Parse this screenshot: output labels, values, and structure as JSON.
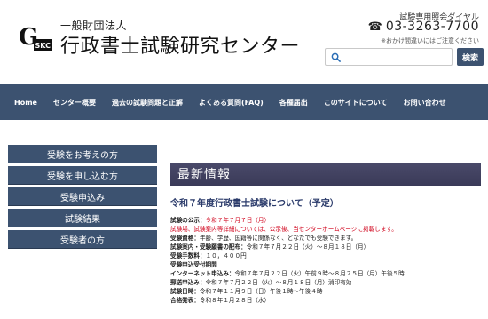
{
  "header": {
    "logo_sub": "一般財団法人",
    "logo_main": "行政書士試験研究センター",
    "tel_label": "試験専用照会ダイヤル",
    "tel_number": "03-3263-7700",
    "tel_note": "※おかけ間違いにはご注意ください",
    "search_placeholder": "",
    "search_button": "検索"
  },
  "nav": {
    "items": [
      "Home",
      "センター概要",
      "過去の試験問題と正解",
      "よくある質問(FAQ)",
      "各種届出",
      "このサイトについて",
      "お問い合わせ"
    ]
  },
  "sidebar": {
    "items": [
      "受験をお考えの方",
      "受験を申し込む方",
      "受験申込み",
      "試験結果",
      "受験者の方"
    ]
  },
  "news": {
    "header": "最新情報",
    "title": "令和７年度行政書士試験について（予定）",
    "lines": [
      {
        "label": "試験の公示：",
        "value": "令和７年７月７日（月）",
        "red": true
      },
      {
        "label": "",
        "value": "試験場、試験案内等詳細については、公示後、当センターホームページに掲載します。",
        "red": true
      },
      {
        "label": "受験資格：",
        "value": "年齢、学歴、国籍等に関係なく、どなたでも受験できます。",
        "red": false
      },
      {
        "label": "試験案内・受験願書の配布：",
        "value": "令和７年７月２２日（火）～８月１８日（月）",
        "red": false
      },
      {
        "label": "受験手数料：",
        "value": "１０，４００円",
        "red": false
      },
      {
        "label": "受験申込受付期間",
        "value": "",
        "red": false
      },
      {
        "label": "インターネット申込み：",
        "value": "令和７年７月２２日（火）午前９時～８月２５日（月）午後５時",
        "red": false
      },
      {
        "label": "郵送申込み：",
        "value": "令和７年７月２２日（火）～８月１８日（月）消印有効",
        "red": false
      },
      {
        "label": "試験日時：",
        "value": "令和７年１１月９日（日）午後１時～午後４時",
        "red": false
      },
      {
        "label": "合格発表：",
        "value": "令和８年１月２８日（水）",
        "red": false
      }
    ]
  }
}
